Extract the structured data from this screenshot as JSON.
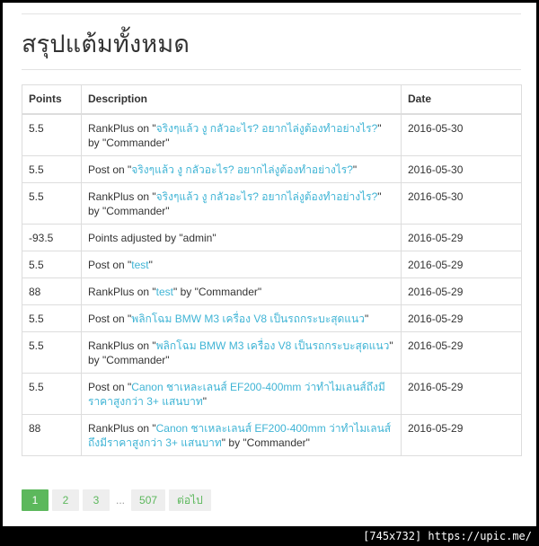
{
  "page": {
    "title": "สรุปแต้มทั้งหมด"
  },
  "table": {
    "headers": {
      "points": "Points",
      "description": "Description",
      "date": "Date"
    },
    "rows": [
      {
        "points": "5.5",
        "prefix": "RankPlus on \"",
        "link": "จริงๆแล้ว งู กลัวอะไร? อยากไล่งูต้องทำอย่างไร?",
        "suffix": "\" by \"Commander\"",
        "date": "2016-05-30"
      },
      {
        "points": "5.5",
        "prefix": "Post on \"",
        "link": "จริงๆแล้ว งู กลัวอะไร? อยากไล่งูต้องทำอย่างไร?",
        "suffix": "\"",
        "date": "2016-05-30"
      },
      {
        "points": "5.5",
        "prefix": "RankPlus on \"",
        "link": "จริงๆแล้ว งู กลัวอะไร? อยากไล่งูต้องทำอย่างไร?",
        "suffix": "\" by \"Commander\"",
        "date": "2016-05-30"
      },
      {
        "points": "-93.5",
        "prefix": "Points adjusted by \"admin\"",
        "link": "",
        "suffix": "",
        "date": "2016-05-29"
      },
      {
        "points": "5.5",
        "prefix": "Post on \"",
        "link": "test",
        "suffix": "\"",
        "date": "2016-05-29"
      },
      {
        "points": "88",
        "prefix": "RankPlus on \"",
        "link": "test",
        "suffix": "\" by \"Commander\"",
        "date": "2016-05-29"
      },
      {
        "points": "5.5",
        "prefix": "Post on \"",
        "link": "พลิกโฉม BMW M3 เครื่อง V8 เป็นรถกระบะสุดแนว",
        "suffix": "\"",
        "date": "2016-05-29"
      },
      {
        "points": "5.5",
        "prefix": "RankPlus on \"",
        "link": "พลิกโฉม BMW M3 เครื่อง V8 เป็นรถกระบะสุดแนว",
        "suffix": "\" by \"Commander\"",
        "date": "2016-05-29"
      },
      {
        "points": "5.5",
        "prefix": "Post on \"",
        "link": "Canon ชาเหละเลนส์ EF200-400mm ว่าทำไมเลนส์ถึงมีราคาสูงกว่า 3+ แสนบาท",
        "suffix": "\"",
        "date": "2016-05-29"
      },
      {
        "points": "88",
        "prefix": "RankPlus on \"",
        "link": "Canon ชาเหละเลนส์ EF200-400mm ว่าทำไมเลนส์ถึงมีราคาสูงกว่า 3+ แสนบาท",
        "suffix": "\" by \"Commander\"",
        "date": "2016-05-29"
      }
    ]
  },
  "pagination": {
    "pages": [
      "1",
      "2",
      "3"
    ],
    "ellipsis": "...",
    "last": "507",
    "next": "ต่อไป",
    "active": "1",
    "accent": "#5cb85c"
  },
  "badge": "[745x732] https://upic.me/"
}
